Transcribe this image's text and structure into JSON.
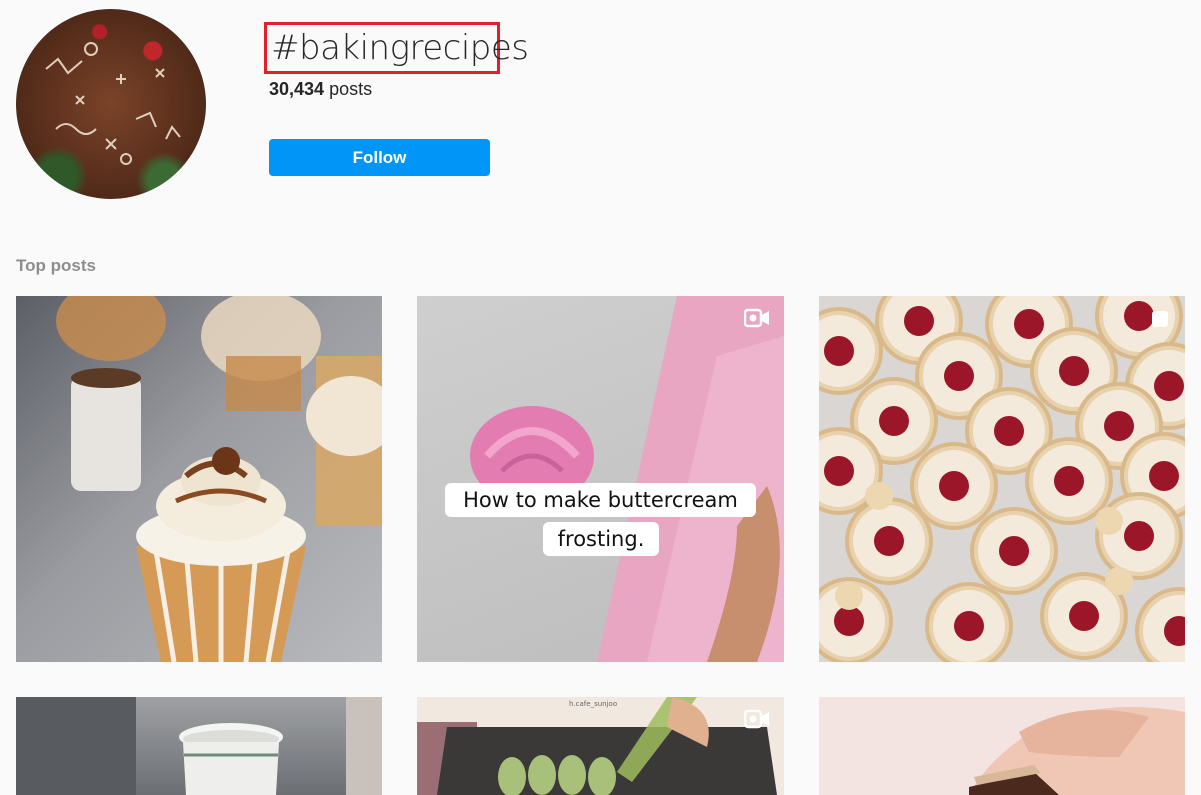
{
  "hashtag": {
    "title": "#bakingrecipes",
    "posts_count": "30,434",
    "posts_suffix": " posts",
    "follow_label": "Follow"
  },
  "top_posts": {
    "label": "Top posts",
    "tiles": [
      {
        "kind": "image",
        "icon": null
      },
      {
        "kind": "video",
        "icon": "video-camera-icon",
        "caption_line1": "How to make buttercream",
        "caption_line2": "frosting."
      },
      {
        "kind": "carousel",
        "icon": "multiple-photos-icon"
      },
      {
        "kind": "image",
        "icon": null
      },
      {
        "kind": "video",
        "icon": "video-camera-icon",
        "watermark": "h.cafe_sunjoo"
      },
      {
        "kind": "image",
        "icon": null
      }
    ]
  },
  "colors": {
    "accent_blue": "#0095f6",
    "highlight_red": "#e0212b",
    "background": "#fafafa"
  }
}
